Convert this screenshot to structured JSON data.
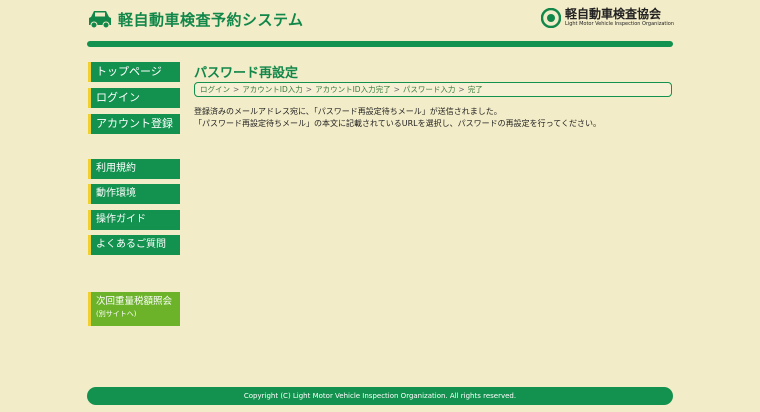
{
  "header": {
    "app_title": "軽自動車検査予約システム",
    "org_name": "軽自動車検査協会",
    "org_name_en": "Light Motor Vehicle Inspection Organization",
    "icons": [
      "car-icon",
      "org-logo-icon"
    ]
  },
  "sidebar": {
    "main_items": [
      {
        "label": "トップページ"
      },
      {
        "label": "ログイン"
      },
      {
        "label": "アカウント登録"
      }
    ],
    "info_items": [
      {
        "label": "利用規約"
      },
      {
        "label": "動作環境"
      },
      {
        "label": "操作ガイド"
      },
      {
        "label": "よくあるご質問"
      }
    ],
    "external": {
      "label": "次回重量税額照会",
      "sub": "(別サイトへ)"
    }
  },
  "main": {
    "title": "パスワード再設定",
    "breadcrumb": [
      "ログイン",
      "アカウントID入力",
      "アカウントID入力完了",
      "パスワード入力",
      "完了"
    ],
    "breadcrumb_sep": ">",
    "message_lines": [
      "登録済みのメールアドレス宛に、「パスワード再設定待ちメール」が送信されました。",
      "「パスワード再設定待ちメール」の本文に記載されているURLを選択し、パスワードの再設定を行ってください。"
    ]
  },
  "footer": {
    "copyright": "Copyright (C) Light Motor Vehicle Inspection Organization. All rights reserved."
  },
  "colors": {
    "background": "#f2ecc8",
    "primary": "#12924e",
    "accent": "#f0d030",
    "external": "#6cb32a"
  }
}
